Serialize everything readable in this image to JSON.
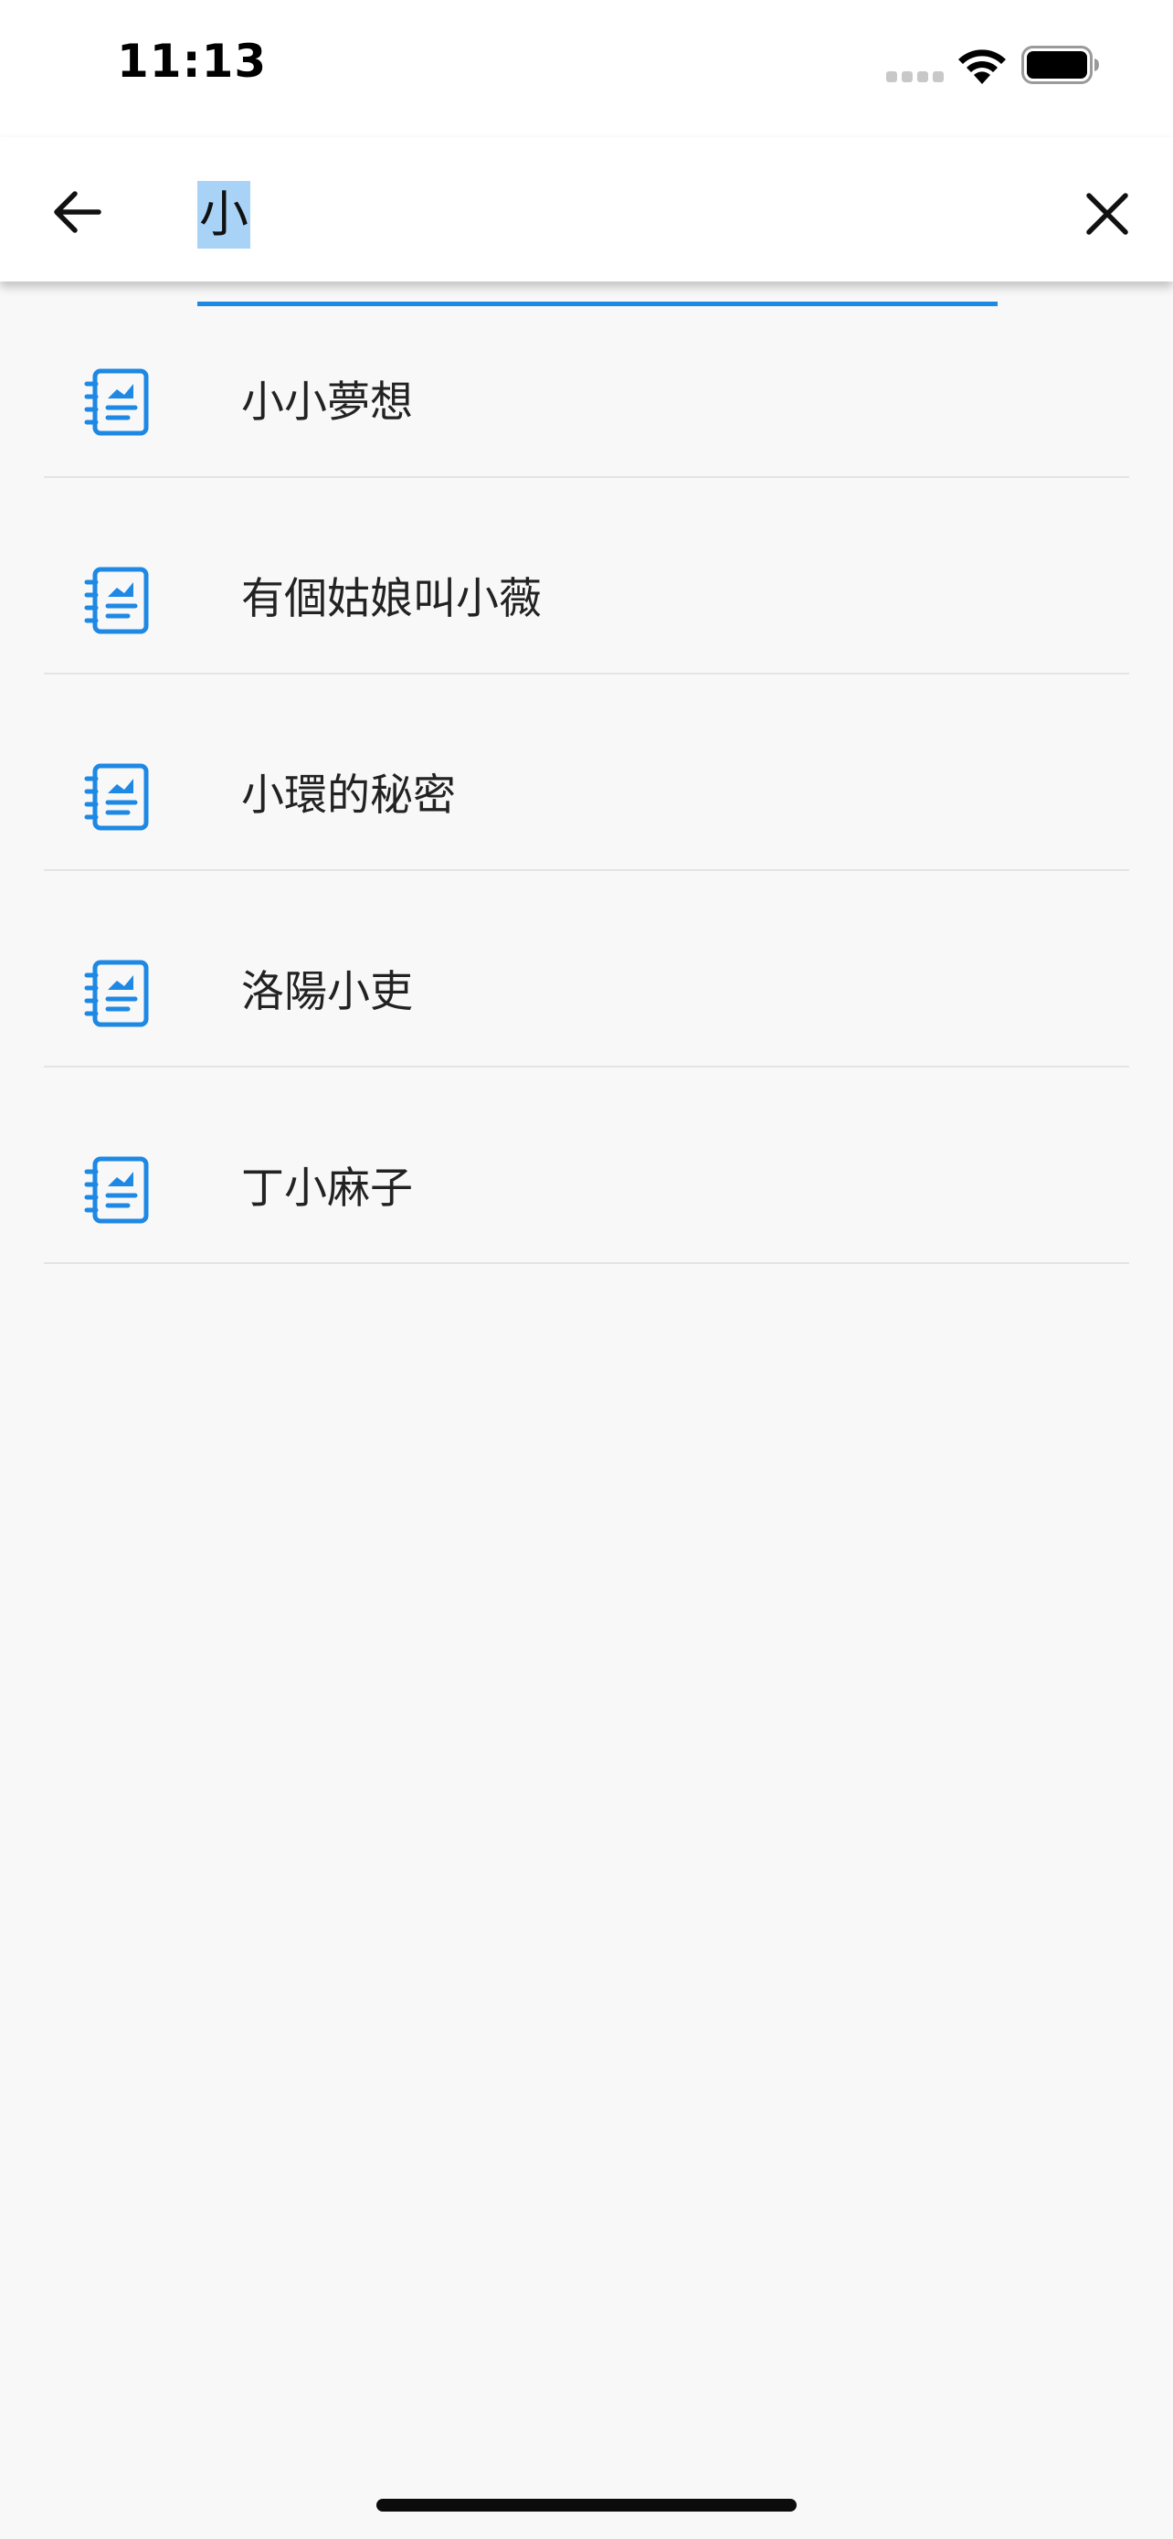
{
  "status_bar": {
    "time": "11:13"
  },
  "search": {
    "query": "小",
    "placeholder": ""
  },
  "results": [
    {
      "title": "小小夢想"
    },
    {
      "title": "有個姑娘叫小薇"
    },
    {
      "title": "小環的秘密"
    },
    {
      "title": "洛陽小吏"
    },
    {
      "title": "丁小麻子"
    }
  ],
  "icons": {
    "back": "arrow-left-icon",
    "clear": "close-icon",
    "item": "notebook-chart-icon"
  },
  "colors": {
    "accent": "#1e88e5",
    "selection": "#a8d3f7",
    "background": "#f8f8f8",
    "appbar": "#ffffff"
  }
}
